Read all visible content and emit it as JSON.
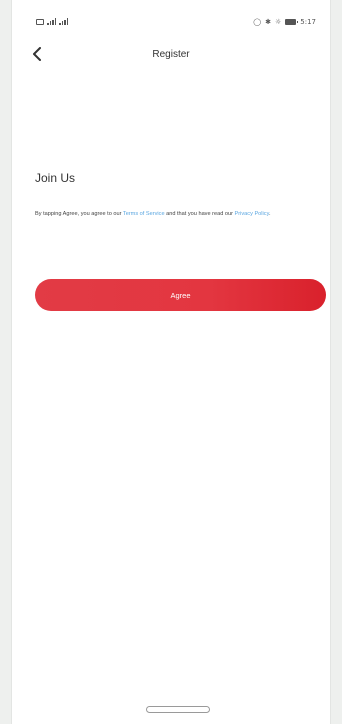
{
  "status_bar": {
    "network_left": "▓▓ ℠℠",
    "icons_right": "○ ✱ ☼",
    "time": "5:17"
  },
  "header": {
    "back_icon": "chevron-left-icon",
    "title": "Register"
  },
  "main": {
    "heading": "Join Us",
    "terms": {
      "prefix": "By tapping Agree, you agree to our ",
      "terms_link": "Terms of Service",
      "middle": " and that you have read our ",
      "privacy_link": "Privacy Policy",
      "suffix": "."
    },
    "agree_label": "Agree"
  },
  "colors": {
    "accent": "#e23b45",
    "link": "#5aa6e0",
    "background": "#ffffff"
  }
}
